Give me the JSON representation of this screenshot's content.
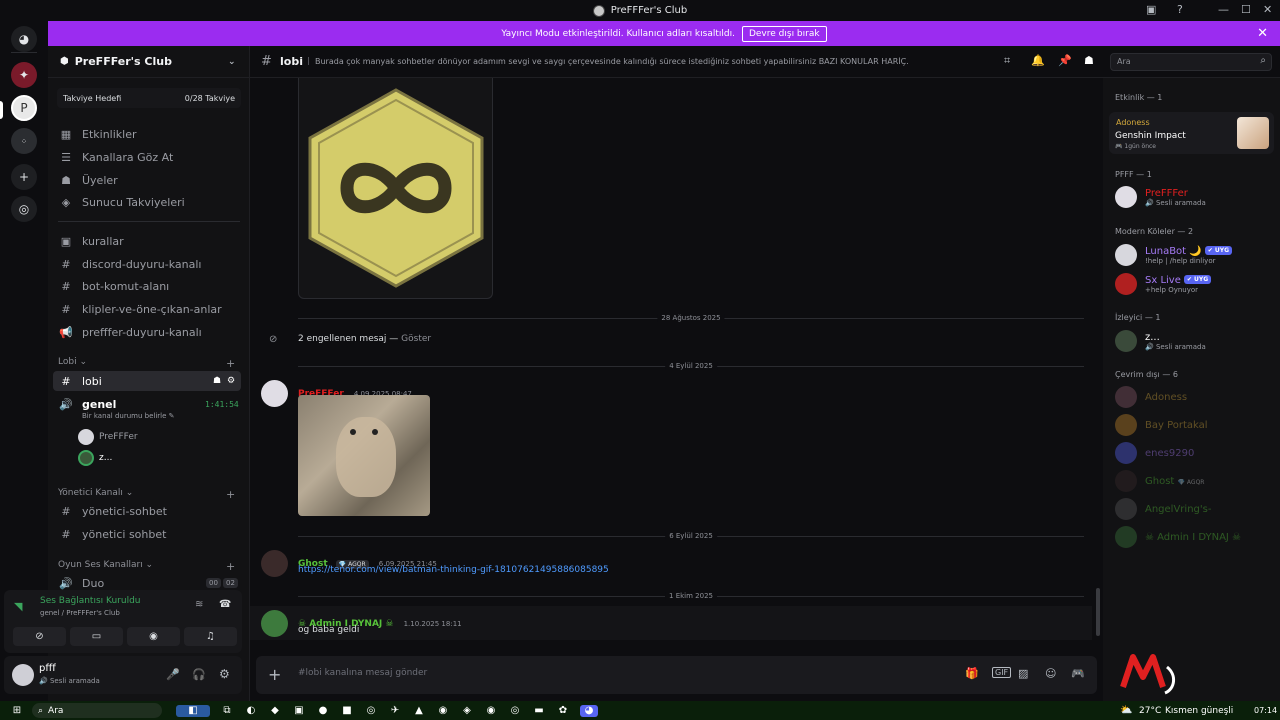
{
  "window": {
    "title": "PreFFFer's Club"
  },
  "banner": {
    "text": "Yayıncı Modu etkinleştirildi. Kullanıcı adları kısaltıldı.",
    "button": "Devre dışı bırak"
  },
  "server": {
    "name": "PreFFFer's Club"
  },
  "boost": {
    "label": "Takviye Hedefi",
    "value": "0/28 Takviye"
  },
  "nav": [
    {
      "icon": "calendar-icon",
      "label": "Etkinlikler"
    },
    {
      "icon": "browse-icon",
      "label": "Kanallara Göz At"
    },
    {
      "icon": "members-icon",
      "label": "Üyeler"
    },
    {
      "icon": "boost-icon",
      "label": "Sunucu Takviyeleri"
    }
  ],
  "channels": [
    {
      "icon": "rules-icon",
      "label": "kurallar"
    },
    {
      "icon": "hash-icon",
      "label": "discord-duyuru-kanalı"
    },
    {
      "icon": "hash-icon",
      "label": "bot-komut-alanı"
    },
    {
      "icon": "hash-icon",
      "label": "klipler-ve-öne-çıkan-anlar"
    },
    {
      "icon": "megaphone-icon",
      "label": "prefffer-duyuru-kanalı"
    }
  ],
  "lobi": {
    "category": "Lobi",
    "active_channel": "lobi",
    "voice_channel": "genel",
    "voice_timer": "1:41:54",
    "voice_status": "Bir kanal durumu belirle",
    "voice_users": [
      "PreFFFer",
      "z..."
    ]
  },
  "admin": {
    "category": "Yönetici Kanalı",
    "channels": [
      "yönetici-sohbet",
      "yönetici sohbet"
    ]
  },
  "game_voice": {
    "category": "Oyun Ses Kanalları",
    "channel": "Duo",
    "count_a": "00",
    "count_b": "02"
  },
  "voice_connection": {
    "title": "Ses Bağlantısı Kuruldu",
    "subtitle": "genel / PreFFFer's Club"
  },
  "user": {
    "name": "pfff",
    "status": "Sesli aramada"
  },
  "header": {
    "channel": "lobi",
    "topic": "Burada çok manyak sohbetler dönüyor adamım sevgi ve saygı çerçevesinde kalındığı sürece istediğiniz sohbeti yapabilirsiniz BAZI KONULAR HARİÇ.",
    "search_placeholder": "Ara"
  },
  "messages": {
    "date1": "28 Ağustos 2025",
    "blocked_text": "2 engellenen mesaj —",
    "blocked_action": "Göster",
    "date2": "4 Eylül 2025",
    "msg1": {
      "author": "PreFFFer",
      "time": "4.09.2025 08:47"
    },
    "date3": "6 Eylül 2025",
    "msg2": {
      "author": "Ghost",
      "tag": "AGQR",
      "time": "6.09.2025 21:45",
      "link": "https://tenor.com/view/batman-thinking-gif-18107621495886085895"
    },
    "date4": "1 Ekim 2025",
    "msg3": {
      "author": "☠ Admin I DYNAJ ☠",
      "time": "1.10.2025 18:11",
      "text": "og baba geldi"
    }
  },
  "composer": {
    "placeholder": "#lobi kanalına mesaj gönder"
  },
  "members": {
    "activity_header": "Etkinlik — 1",
    "activity": {
      "name": "Adoness",
      "game": "Genshin Impact",
      "time": "1gün önce"
    },
    "role1_header": "PFFF — 1",
    "role1": [
      {
        "name": "PreFFFer",
        "sub": "Sesli aramada"
      }
    ],
    "role2_header": "Modern Köleler — 2",
    "role2": [
      {
        "name": "LunaBot 🌙",
        "badge": "UYG",
        "sub": "!help | /help dinliyor"
      },
      {
        "name": "Sx Live",
        "badge": "UYG",
        "sub": "+help Oynuyor"
      }
    ],
    "role3_header": "İzleyici — 1",
    "role3": [
      {
        "name": "z...",
        "sub": "Sesli aramada"
      }
    ],
    "offline_header": "Çevrim dışı — 6",
    "offline": [
      "Adoness",
      "Bay Portakal",
      "enes9290",
      "Ghost",
      "AngelVring's-",
      "☠ Admin I DYNAJ ☠"
    ],
    "ghost_tag": "AGQR"
  },
  "taskbar": {
    "search": "Ara",
    "weather": "27°C",
    "weather_text": "Kısmen güneşli",
    "time": "07:14"
  },
  "colors": {
    "accent": "#9b2cf0",
    "prefffer": "#e02020",
    "ghost": "#57c23a",
    "link": "#4f9bff",
    "bot": "#a57bf5"
  }
}
